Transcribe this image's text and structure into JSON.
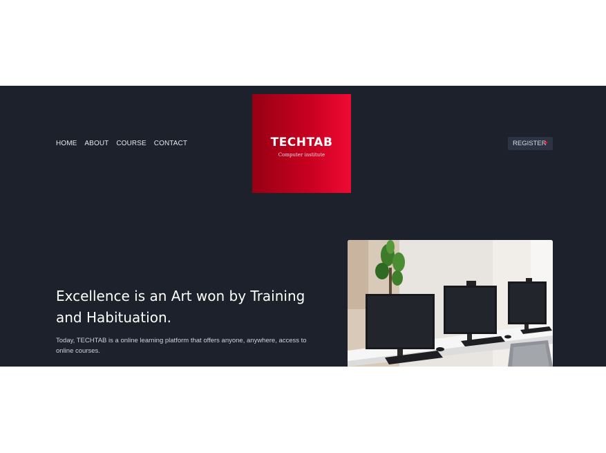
{
  "nav": {
    "items": [
      "HOME",
      "ABOUT",
      "COURSE",
      "CONTACT"
    ]
  },
  "logo": {
    "title": "TECHTAB",
    "subtitle": "Computer institute"
  },
  "register": {
    "label": "REGISTER"
  },
  "hero": {
    "headline": "Excellence is an Art won by Training and Habituation.",
    "description": "Today, TECHTAB is a online learning platform that offers anyone, anywhere, access to online courses."
  },
  "colors": {
    "background": "#1c212b",
    "accent": "#e0142f",
    "logo_gradient_start": "#970014",
    "logo_gradient_end": "#ef0a33"
  },
  "icons": {
    "register_dropdown": "chevron-down-icon"
  }
}
